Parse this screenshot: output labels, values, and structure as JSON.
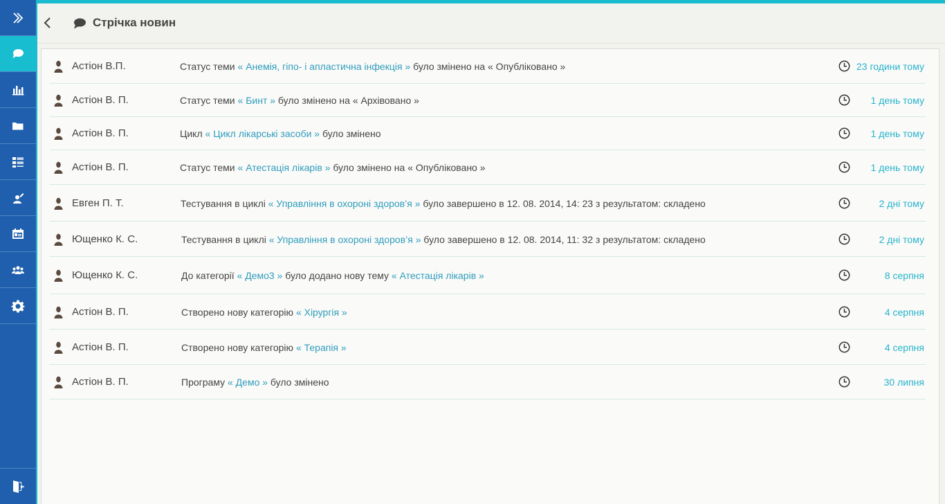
{
  "header": {
    "title": "Стрічка новин"
  },
  "sidebar": {
    "items": [
      {
        "name": "expand",
        "icon": "double-chevron-right-icon"
      },
      {
        "name": "feed",
        "icon": "chat-bubble-icon",
        "active": true
      },
      {
        "name": "statistics",
        "icon": "bar-chart-icon"
      },
      {
        "name": "folders",
        "icon": "folder-icon"
      },
      {
        "name": "lists",
        "icon": "list-icon"
      },
      {
        "name": "users",
        "icon": "user-edit-icon"
      },
      {
        "name": "calendar",
        "icon": "calendar-icon"
      },
      {
        "name": "groups",
        "icon": "group-icon"
      },
      {
        "name": "settings",
        "icon": "gear-icon"
      }
    ],
    "logout_icon": "logout-door-icon"
  },
  "colors": {
    "sidebar": "#1f5fad",
    "accent": "#1bbcd0",
    "link": "#2e9cbd",
    "time": "#26b3cc"
  },
  "feed": [
    {
      "user": "Астіон В.П.",
      "parts": [
        {
          "t": "Статус теми "
        },
        {
          "t": "« Анемія, гіпо- і апластична інфекція »",
          "link": true
        },
        {
          "t": " було змінено на « Опубліковано »"
        }
      ],
      "time": "23 години тому"
    },
    {
      "user": "Астіон В. П.",
      "parts": [
        {
          "t": "Статус теми "
        },
        {
          "t": "« Бинт »",
          "link": true
        },
        {
          "t": " було змінено на « Архівовано »"
        }
      ],
      "time": "1 день тому"
    },
    {
      "user": "Астіон В. П.",
      "parts": [
        {
          "t": "Цикл "
        },
        {
          "t": "« Цикл лікарські засоби »",
          "link": true
        },
        {
          "t": " було змінено"
        }
      ],
      "time": "1 день тому"
    },
    {
      "user": "Астіон В. П.",
      "parts": [
        {
          "t": "Статус теми "
        },
        {
          "t": "« Атестація лікарів »",
          "link": true
        },
        {
          "t": " було змінено на « Опубліковано »"
        }
      ],
      "time": "1 день тому"
    },
    {
      "user": "Евген П. Т.",
      "parts": [
        {
          "t": "Тестування в циклі "
        },
        {
          "t": "« Управління в охороні здоров’я »",
          "link": true
        },
        {
          "t": " було завершено в 12. 08. 2014, 14: 23 з результатом: складено"
        }
      ],
      "time": "2 дні тому"
    },
    {
      "user": "Ющенко К. С.",
      "parts": [
        {
          "t": "Тестування в циклі "
        },
        {
          "t": "« Управління в охороні здоров’я »",
          "link": true
        },
        {
          "t": " було завершено в 12. 08. 2014, 11: 32 з результатом: складено"
        }
      ],
      "time": "2 дні тому"
    },
    {
      "user": "Ющенко К. С.",
      "parts": [
        {
          "t": "До категорії "
        },
        {
          "t": "« Демо3 »",
          "link": true
        },
        {
          "t": " було додано нову тему "
        },
        {
          "t": "« Атестація лікарів »",
          "link": true
        }
      ],
      "time": "8 серпня"
    },
    {
      "user": "Астіон В. П.",
      "parts": [
        {
          "t": "Створено нову категорію "
        },
        {
          "t": "« Хірургія »",
          "link": true
        }
      ],
      "time": "4 серпня"
    },
    {
      "user": "Астіон В. П.",
      "parts": [
        {
          "t": "Створено нову категорію "
        },
        {
          "t": "« Терапія »",
          "link": true
        }
      ],
      "time": "4 серпня"
    },
    {
      "user": "Астіон В. П.",
      "parts": [
        {
          "t": "Програму "
        },
        {
          "t": "« Демо »",
          "link": true
        },
        {
          "t": " було змінено"
        }
      ],
      "time": "30 липня"
    }
  ]
}
